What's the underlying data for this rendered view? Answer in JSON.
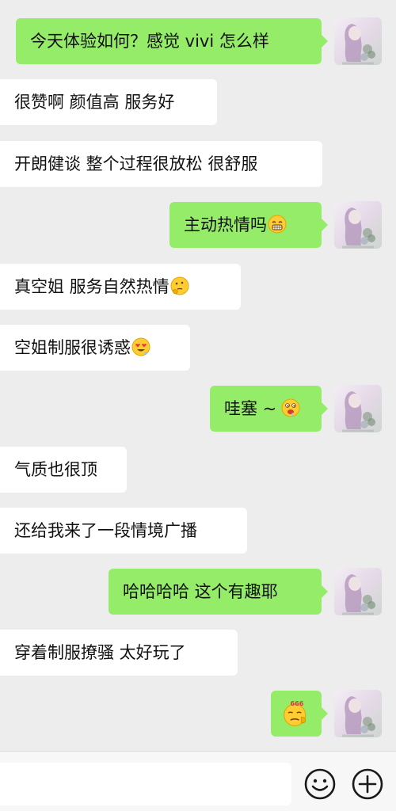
{
  "conversation": {
    "messages": [
      {
        "side": "out",
        "text": "今天体验如何？感觉 vivi 怎么样",
        "emoji": ""
      },
      {
        "side": "in",
        "text": "很赞啊 颜值高 服务好",
        "emoji": ""
      },
      {
        "side": "in",
        "text": "开朗健谈 整个过程很放松 很舒服",
        "emoji": ""
      },
      {
        "side": "out",
        "text": "主动热情吗",
        "emoji": "grin-sweat-emoji"
      },
      {
        "side": "in",
        "text": "真空姐 服务自然热情",
        "emoji": "thinking-emoji"
      },
      {
        "side": "in",
        "text": "空姐制服很诱惑",
        "emoji": "heart-eyes-emoji"
      },
      {
        "side": "out",
        "text": "哇塞 ~",
        "emoji": "drooling-emoji"
      },
      {
        "side": "in",
        "text": "气质也很顶",
        "emoji": ""
      },
      {
        "side": "in",
        "text": "还给我来了一段情境广播",
        "emoji": ""
      },
      {
        "side": "out",
        "text": "哈哈哈哈 这个有趣耶",
        "emoji": ""
      },
      {
        "side": "in",
        "text": "穿着制服撩骚  太好玩了",
        "emoji": ""
      },
      {
        "side": "out",
        "text": "",
        "emoji": "666-emoji"
      }
    ],
    "emoji_badge_text": "666"
  },
  "composer": {
    "input_value": "",
    "emoji_button_icon": "smiley-icon",
    "more_button_icon": "plus-circle-icon"
  },
  "colors": {
    "background": "#ededed",
    "outgoing_bubble": "#95ec69",
    "incoming_bubble": "#ffffff",
    "emoji_yellow": "#ffcc33"
  }
}
